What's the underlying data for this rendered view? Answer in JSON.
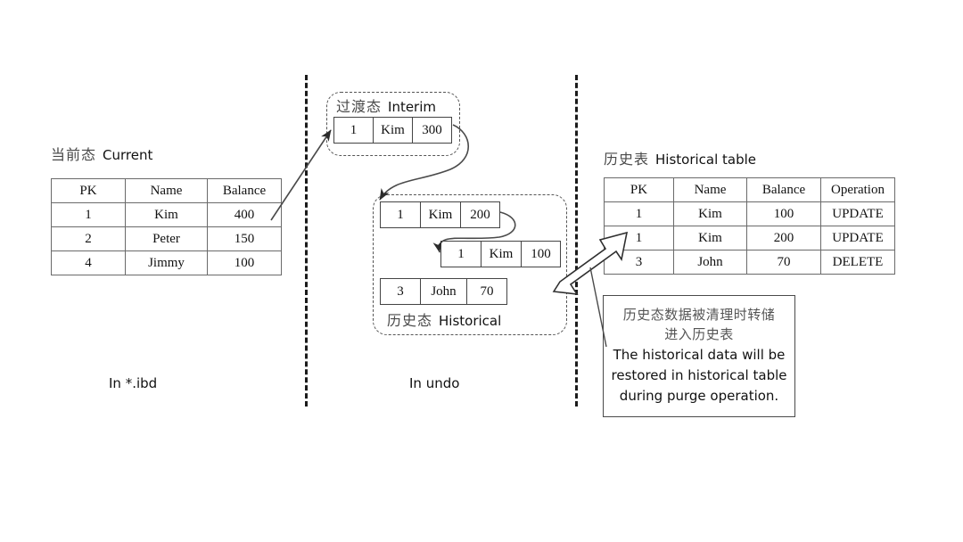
{
  "zones": {
    "left_caption": "In *.ibd",
    "middle_caption": "In undo"
  },
  "current": {
    "title_cn": "当前态",
    "title_en": "Current",
    "columns": [
      "PK",
      "Name",
      "Balance"
    ],
    "rows": [
      [
        "1",
        "Kim",
        "400"
      ],
      [
        "2",
        "Peter",
        "150"
      ],
      [
        "4",
        "Jimmy",
        "100"
      ]
    ]
  },
  "interim": {
    "title_cn": "过渡态",
    "title_en": "Interim",
    "record": [
      "1",
      "Kim",
      "300"
    ]
  },
  "historical_undo": {
    "label_cn": "历史态",
    "label_en": "Historical",
    "records": [
      [
        "1",
        "Kim",
        "200"
      ],
      [
        "1",
        "Kim",
        "100"
      ],
      [
        "3",
        "John",
        "70"
      ]
    ]
  },
  "historical_table": {
    "title_cn": "历史表",
    "title_en": "Historical table",
    "columns": [
      "PK",
      "Name",
      "Balance",
      "Operation"
    ],
    "rows": [
      [
        "1",
        "Kim",
        "100",
        "UPDATE"
      ],
      [
        "1",
        "Kim",
        "200",
        "UPDATE"
      ],
      [
        "3",
        "John",
        "70",
        "DELETE"
      ]
    ]
  },
  "callout": {
    "cn_line1": "历史态数据被清理时转储",
    "cn_line2": "进入历史表",
    "en_line1": "The historical data will be",
    "en_line2": "restored in historical table",
    "en_line3": "during purge operation."
  },
  "colors": {
    "stroke": "#4a4a4a",
    "divider": "#1b1b1b",
    "text": "#111111"
  }
}
